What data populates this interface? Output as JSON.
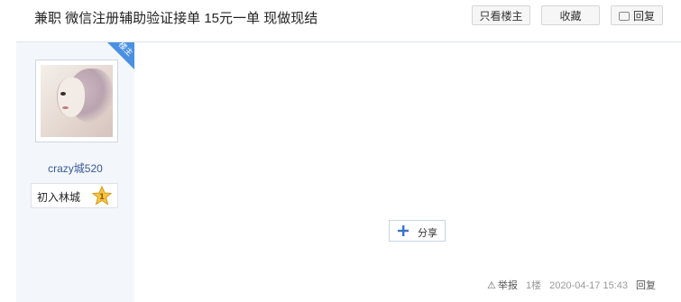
{
  "thread": {
    "title": "兼职 微信注册辅助验证接单 15元一单 现做现结"
  },
  "header_buttons": {
    "only_op_label": "只看楼主",
    "favorite_label": "收藏",
    "reply_label": "回复"
  },
  "author": {
    "username": "crazy城520",
    "op_badge": "楼主",
    "level_name": "初入林城",
    "level_number": "1"
  },
  "share": {
    "label": "分享"
  },
  "post_meta": {
    "report_label": "举报",
    "floor": "1楼",
    "timestamp": "2020-04-17 15:43",
    "reply_label": "回复"
  },
  "colors": {
    "accent": "#4a90e2",
    "sidebar_bg": "#f3f7fb",
    "username": "#3b5998"
  }
}
